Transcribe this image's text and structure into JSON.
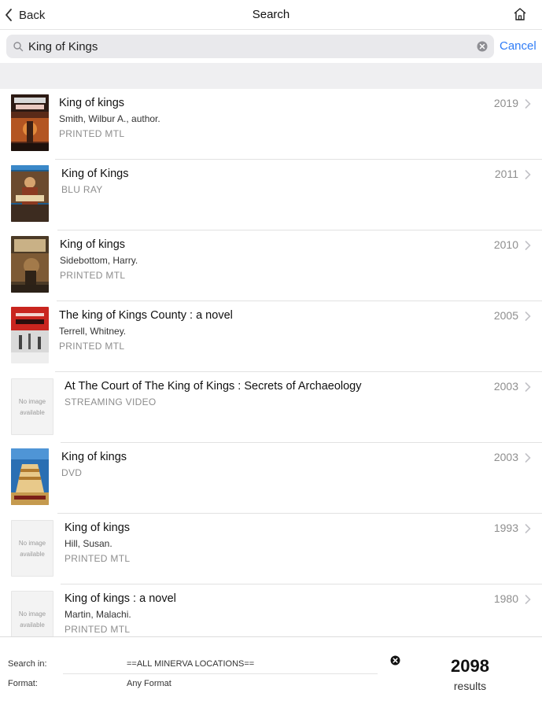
{
  "nav": {
    "back_label": "Back",
    "title": "Search"
  },
  "search": {
    "value": "King of Kings",
    "cancel_label": "Cancel"
  },
  "results": [
    {
      "title": "King of kings",
      "author": "Smith, Wilbur A., author.",
      "format": "PRINTED MTL",
      "year": "2019",
      "cover": "book-cover"
    },
    {
      "title": "King of Kings",
      "author": "",
      "format": "BLU RAY",
      "year": "2011",
      "cover": "bluray-cover"
    },
    {
      "title": "King of kings",
      "author": "Sidebottom, Harry.",
      "format": "PRINTED MTL",
      "year": "2010",
      "cover": "book-cover"
    },
    {
      "title": "The king of Kings County : a novel",
      "author": "Terrell, Whitney.",
      "format": "PRINTED MTL",
      "year": "2005",
      "cover": "book-cover"
    },
    {
      "title": "At The Court of The King of Kings : Secrets of Archaeology",
      "author": "",
      "format": "STREAMING VIDEO",
      "year": "2003",
      "cover": "no-image",
      "no_image_text": "No image available"
    },
    {
      "title": "King of kings",
      "author": "",
      "format": "DVD",
      "year": "2003",
      "cover": "dvd-cover"
    },
    {
      "title": "King of kings",
      "author": "Hill, Susan.",
      "format": "PRINTED MTL",
      "year": "1993",
      "cover": "no-image",
      "no_image_text": "No image available"
    },
    {
      "title": "King of kings : a novel",
      "author": "Martin, Malachi.",
      "format": "PRINTED MTL",
      "year": "1980",
      "cover": "no-image",
      "no_image_text": "No image available"
    }
  ],
  "footer": {
    "search_in_label": "Search in:",
    "search_in_value": "==ALL MINERVA LOCATIONS==",
    "format_label": "Format:",
    "format_value": "Any Format",
    "result_count": "2098",
    "results_label": "results"
  },
  "colors": {
    "accent": "#2f7cf6",
    "secondary_text": "#8d8d8d",
    "search_bg": "#e9e9ec",
    "band_bg": "#efeff1"
  },
  "icons": {
    "back": "chevron-left-icon",
    "home": "home-icon",
    "search": "magnifier-icon",
    "clear": "clear-circle-icon",
    "row_chevron": "chevron-right-icon"
  }
}
